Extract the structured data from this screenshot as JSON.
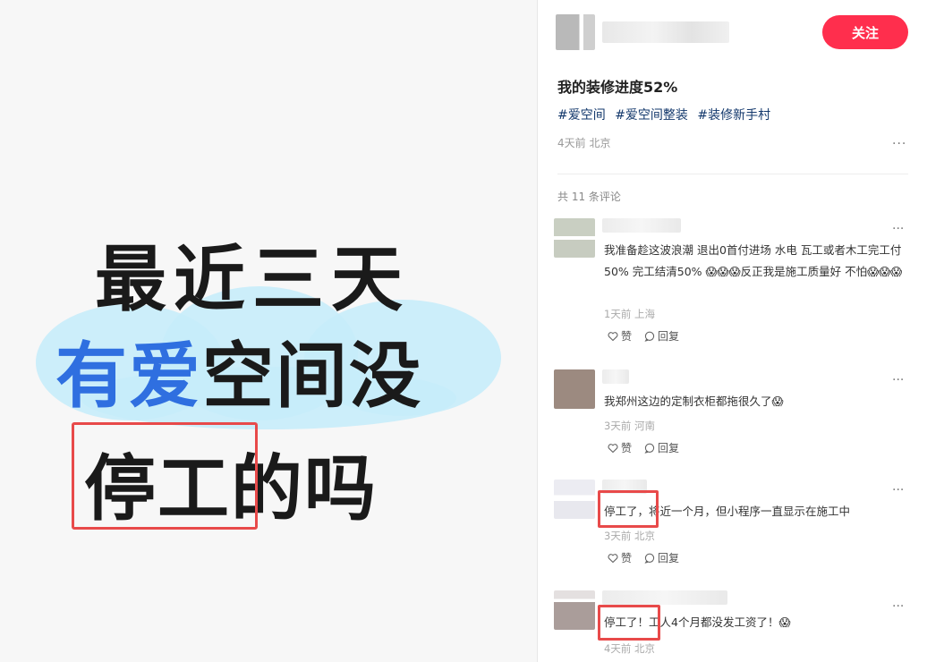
{
  "image": {
    "line1": "最近三天",
    "line2_blue": "有爱",
    "line2_rest": "空间没",
    "line3_boxed": "停工",
    "line3_rest": "的吗"
  },
  "author": {
    "follow_label": "关注"
  },
  "post": {
    "title": "我的装修进度52%",
    "tags": [
      "#爱空间",
      "#爱空间整装",
      "#装修新手村"
    ],
    "meta": "4天前 北京",
    "more": "···"
  },
  "comments_header": "共 11 条评论",
  "comments": [
    {
      "text": "我准备趁这波浪潮 退出0首付进场 水电 瓦工或者木工完工付50% 完工结清50% 😱😱😱反正我是施工质量好 不怕😱😱😱",
      "meta": "1天前 上海",
      "like": "赞",
      "reply": "回复",
      "more": "···"
    },
    {
      "text": "我郑州这边的定制衣柜都拖很久了😱",
      "meta": "3天前 河南",
      "like": "赞",
      "reply": "回复",
      "more": "···"
    },
    {
      "text_boxed": "停工了，",
      "text_rest": "将近一个月，但小程序一直显示在施工中",
      "meta": "3天前 北京",
      "like": "赞",
      "reply": "回复",
      "more": "···"
    },
    {
      "text_boxed": "停工了！",
      "text_rest": "工人4个月都没发工资了！😱",
      "meta": "4天前 北京",
      "more": "···"
    }
  ],
  "colors": {
    "follow_button": "#ff2e4d",
    "tag": "#13386c",
    "highlight_box": "#e84a4a",
    "headline_blue": "#2f6fe0",
    "cloud": "#c6ecfa"
  }
}
